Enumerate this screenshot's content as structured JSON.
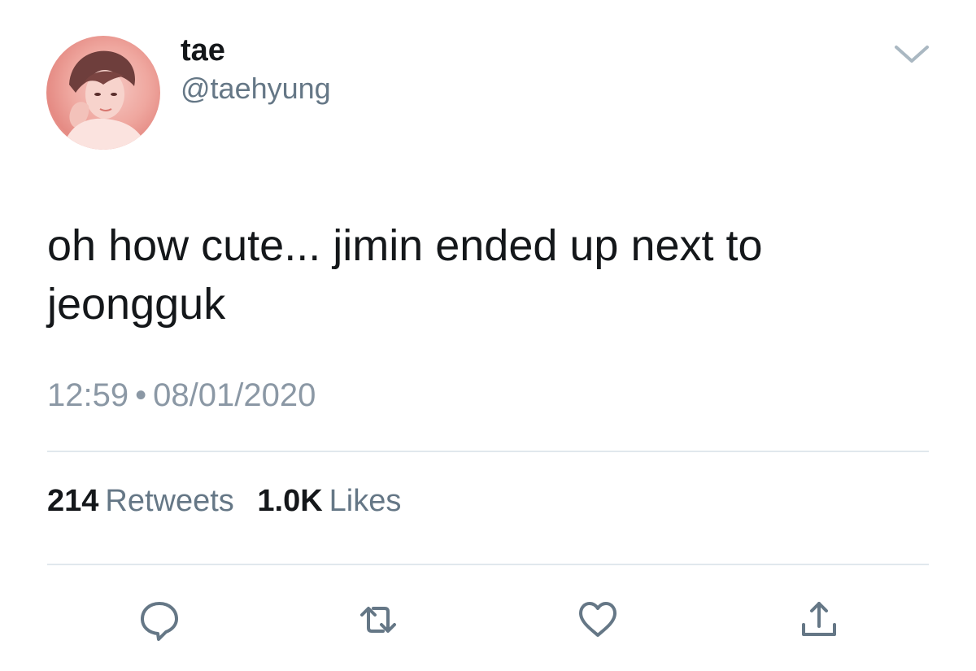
{
  "tweet": {
    "author": {
      "display_name": "tae",
      "handle": "@taehyung",
      "avatar_icon": "profile-photo"
    },
    "text": "oh how cute... jimin ended up next to jeongguk",
    "time": "12:59",
    "separator": "•",
    "date": "08/01/2020",
    "stats": {
      "retweets_count": "214",
      "retweets_label": "Retweets",
      "likes_count": "1.0K",
      "likes_label": "Likes"
    },
    "actions": [
      {
        "icon": "reply-icon"
      },
      {
        "icon": "retweet-icon"
      },
      {
        "icon": "like-icon"
      },
      {
        "icon": "share-icon"
      }
    ]
  },
  "colors": {
    "text_primary": "#14171a",
    "text_secondary": "#657786",
    "meta_gray": "#8b98a5",
    "divider": "#e1e8ed",
    "icon_gray": "#657786"
  }
}
